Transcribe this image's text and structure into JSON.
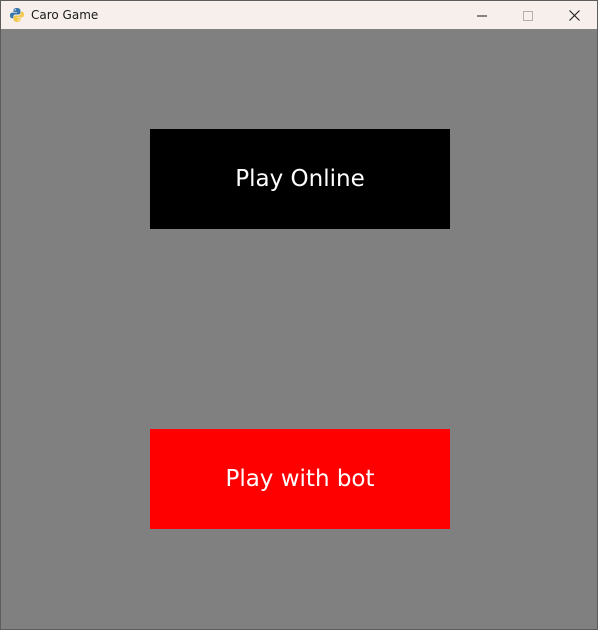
{
  "window": {
    "title": "Caro Game",
    "app_icon": "python-icon"
  },
  "title_controls": {
    "minimize_icon": "minimize-icon",
    "maximize_icon": "maximize-icon",
    "close_icon": "close-icon"
  },
  "menu": {
    "play_online_label": "Play Online",
    "play_bot_label": "Play with bot"
  },
  "colors": {
    "background": "#808080",
    "titlebar": "#f7efec",
    "play_online_bg": "#000000",
    "play_bot_bg": "#ff0000",
    "button_text": "#ffffff"
  }
}
